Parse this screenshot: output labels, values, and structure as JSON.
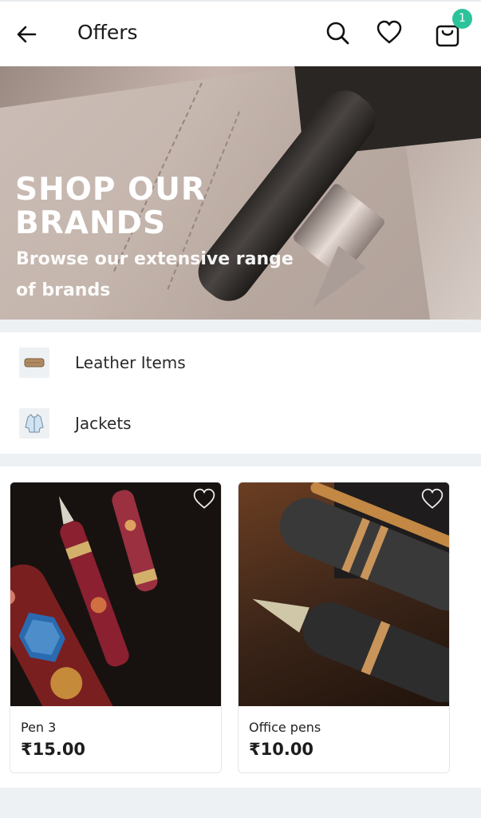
{
  "header": {
    "title": "Offers",
    "cart_count": "1"
  },
  "banner": {
    "heading_line1": "SHOP OUR",
    "heading_line2": "BRANDS",
    "sub_line1": "Browse our extensive range",
    "sub_line2": "of brands"
  },
  "categories": [
    {
      "label": "Leather Items",
      "icon": "leather-wallet-icon"
    },
    {
      "label": "Jackets",
      "icon": "jacket-icon"
    }
  ],
  "products": [
    {
      "name": "Pen 3",
      "price": "₹15.00"
    },
    {
      "name": "Office pens",
      "price": "₹10.00"
    }
  ],
  "colors": {
    "badge": "#2cc39a"
  }
}
